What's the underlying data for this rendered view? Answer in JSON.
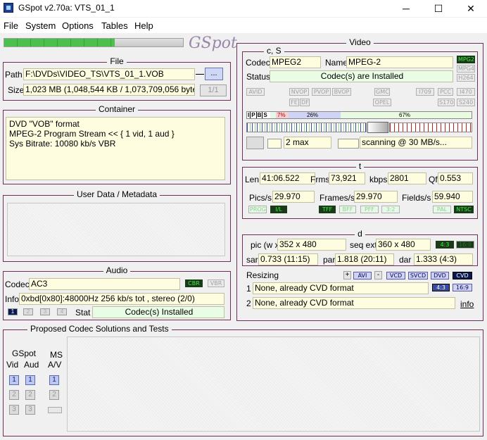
{
  "window": {
    "title": "GSpot v2.70a: VTS_01_1",
    "minimize": "─",
    "maximize": "☐",
    "close": "✕"
  },
  "menu": {
    "file": "File",
    "system": "System",
    "options": "Options",
    "tables": "Tables",
    "help": "Help"
  },
  "progress": {
    "fill_fraction": 0.62
  },
  "logo": "GSpot",
  "file": {
    "title": "File",
    "path_label": "Path",
    "path": "F:\\DVDs\\VIDEO_TS\\VTS_01_1.VOB",
    "browse": "...",
    "size_label": "Size",
    "size": "1,023 MB (1,048,544 KB / 1,073,709,056 bytes)",
    "page": "1/1"
  },
  "container": {
    "title": "Container",
    "lines": [
      "DVD \"VOB\" format",
      "MPEG-2 Program Stream << { 1 vid, 1 aud }",
      "Sys Bitrate: 10080 kb/s VBR"
    ]
  },
  "userdata": {
    "title": "User Data / Metadata"
  },
  "audio": {
    "title": "Audio",
    "codec_label": "Codec",
    "codec": "AC3",
    "cbr": "CBR",
    "vbr": "VBR",
    "info_label": "Info",
    "info": "0xbd[0x80]:48000Hz  256 kb/s tot , stereo (2/0)",
    "stat_label": "Stat",
    "stat": "Codec(s) Installed",
    "streams": [
      "1",
      "2",
      "3",
      "4"
    ]
  },
  "video": {
    "title": "Video",
    "cs": {
      "title": "c, S",
      "codec_label": "Codec",
      "codec": "MPEG2",
      "name_label": "Name",
      "name": "MPEG-2",
      "status_label": "Status",
      "status": "Codec(s) are Installed",
      "tags_right": [
        "MPG2",
        "MPG4",
        "H264"
      ]
    },
    "flags": {
      "row1": [
        "AVID",
        "NVOP",
        "PVOP",
        "BVOP",
        "GMC",
        "I709",
        "PCC",
        "I470"
      ],
      "row2": [
        "FE",
        "DF",
        "OPEL",
        "S170",
        "S240"
      ]
    },
    "gop": {
      "frames": [
        "I",
        "P",
        "B",
        "S"
      ],
      "pct1": "7%",
      "pct2": "26%",
      "pct3": "67%",
      "ibp": "2 max",
      "scan": "scanning @ 30 MB/s..."
    },
    "t": {
      "title": "t",
      "len_label": "Len",
      "len": "41:06.522",
      "frms_label": "Frms",
      "frms": "73,921",
      "kbps_label": "kbps",
      "kbps": "2801",
      "qf_label": "Qf",
      "qf": "0.553",
      "pics_label": "Pics/s",
      "pics": "29.970",
      "frames_label": "Frames/s",
      "frames": "29.970",
      "fields_label": "Fields/s",
      "fields": "59.940",
      "tags": [
        "PROG",
        "I/L",
        "TFF",
        "BFF",
        "PFF",
        "3:2",
        "PAL",
        "NTSC"
      ]
    },
    "d": {
      "title": "d",
      "pic_label": "pic (w x",
      "pic": "352 x 480",
      "seq_label": "seq ext",
      "seq": "360 x 480",
      "ar1": "4:3",
      "ar2": "16:9",
      "sar_label": "sar",
      "sar": "0.733 (11:15)",
      "par_label": "par",
      "par": "1.818 (20:11)",
      "dar_label": "dar",
      "dar": "1.333 (4:3)"
    },
    "resize": {
      "label": "Resizing",
      "plus": "+",
      "avi": "AVI",
      "minus": "-",
      "vcd": "VCD",
      "svcd": "SVCD",
      "dvd": "DVD",
      "cvd": "CVD",
      "row1_num": "1",
      "row1": "None, already CVD format",
      "row2_num": "2",
      "row2": "None, already CVD format",
      "r43": "4:3",
      "r169": "16:9",
      "info": "info"
    }
  },
  "proposed": {
    "title": "Proposed Codec Solutions and Tests",
    "gspot": "GSpot",
    "vid": "Vid",
    "aud": "Aud",
    "ms": "MS",
    "av": "A/V",
    "n1": "1",
    "n2": "2",
    "n3": "3"
  }
}
